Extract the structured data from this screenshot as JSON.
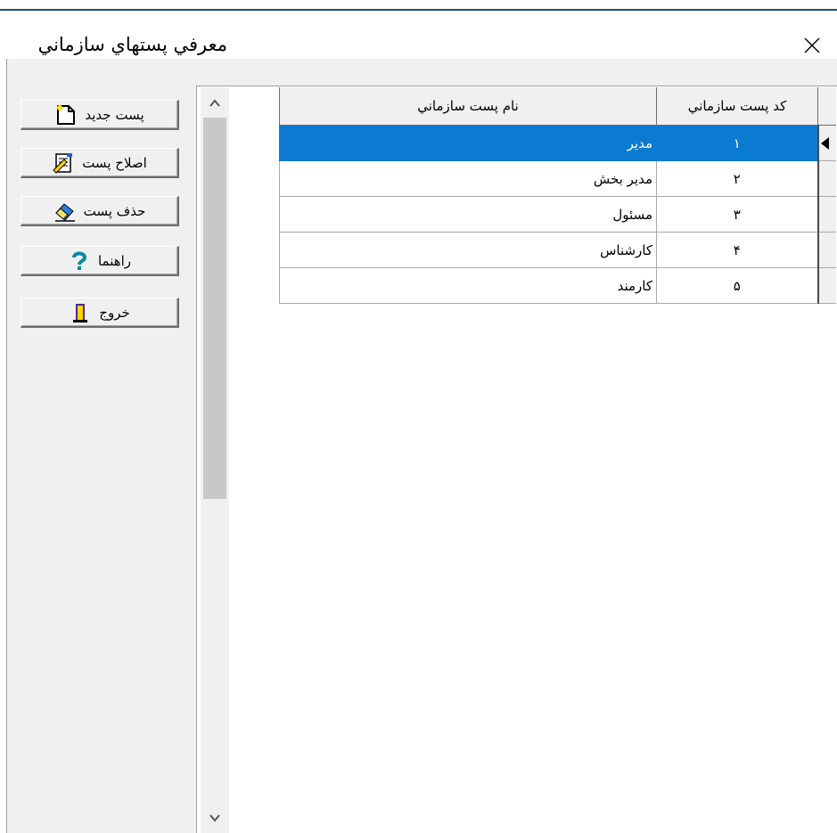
{
  "window": {
    "title": "معرفي پستهاي سازماني",
    "close_icon": "close-icon"
  },
  "buttons": [
    {
      "label": "پست جديد",
      "icon": "new-document-icon"
    },
    {
      "label": "اصلاح پست",
      "icon": "edit-document-icon"
    },
    {
      "label": "حذف پست",
      "icon": "delete-eraser-icon"
    },
    {
      "label": "راهنما",
      "icon": "question-mark-icon"
    },
    {
      "label": "خروج",
      "icon": "exit-door-icon"
    }
  ],
  "grid": {
    "columns": {
      "name": "نام پست سازماني",
      "code": "کد پست سازماني"
    },
    "rows": [
      {
        "code": "۱",
        "name": "مدير"
      },
      {
        "code": "۲",
        "name": "مدير بخش"
      },
      {
        "code": "۳",
        "name": "مسئول"
      },
      {
        "code": "۴",
        "name": "کارشناس"
      },
      {
        "code": "۵",
        "name": "کارمند"
      }
    ],
    "selected_row": 1
  },
  "colors": {
    "selection": "#0b7ad1",
    "title_line": "#1f4f7a"
  }
}
